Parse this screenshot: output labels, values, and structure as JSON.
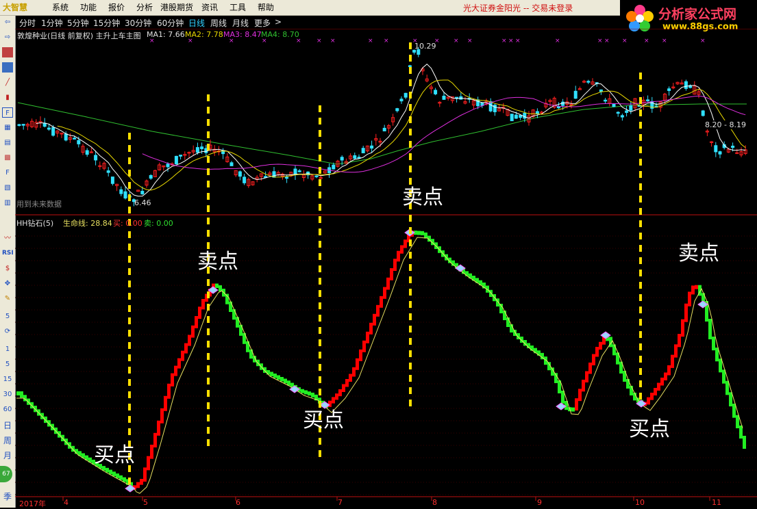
{
  "app": {
    "logo_text": "大智慧",
    "status_text": "光大证券金阳光 -- 交易未登录"
  },
  "menu": [
    "系统",
    "功能",
    "报价",
    "分析",
    "港股期货",
    "资讯",
    "工具",
    "帮助"
  ],
  "brand": {
    "name": "分析家公式网",
    "url": "www.88gs.com"
  },
  "period_tabs": [
    "分时",
    "1分钟",
    "5分钟",
    "15分钟",
    "30分钟",
    "60分钟",
    "日线",
    "周线",
    "月线",
    "更多"
  ],
  "period_active": "日线",
  "more_arrow": ">",
  "toolbar_side": [
    "RSI",
    "5",
    "1",
    "5",
    "15",
    "30",
    "60",
    "日",
    "周",
    "月",
    "季"
  ],
  "toolbar_badge": "67",
  "main": {
    "title": "敦煌种业(日线 前复权) 主升上车主图",
    "ma1": "MA1: 7.66",
    "ma2": "MA2: 7.78",
    "ma3": "MA3: 8.47",
    "ma4": "MA4: 8.70",
    "high_label": "10.29",
    "low_label": "6.46",
    "range_label": "8.20 - 8.19",
    "future_note": "用到未来数据"
  },
  "sub": {
    "title": "HH钻石(5)",
    "line1": "生命线: 28.84",
    "line2": "买: 0.00",
    "line3": "卖: 0.00"
  },
  "annotations": {
    "buy": "买点",
    "sell": "卖点"
  },
  "xaxis": {
    "year": "2017年",
    "months": [
      "4",
      "5",
      "6",
      "7",
      "8",
      "9",
      "10",
      "11"
    ]
  },
  "colors": {
    "up": "#ff2020",
    "down": "#30e0ff",
    "ma1": "#ffffff",
    "ma2": "#e8d800",
    "ma3": "#e030e0",
    "ma4": "#30c030",
    "sub_up": "#ff0000",
    "sub_down": "#22ee22",
    "life": "#e8e060",
    "dash": "#ffe000",
    "grid": "#8b0000"
  }
}
